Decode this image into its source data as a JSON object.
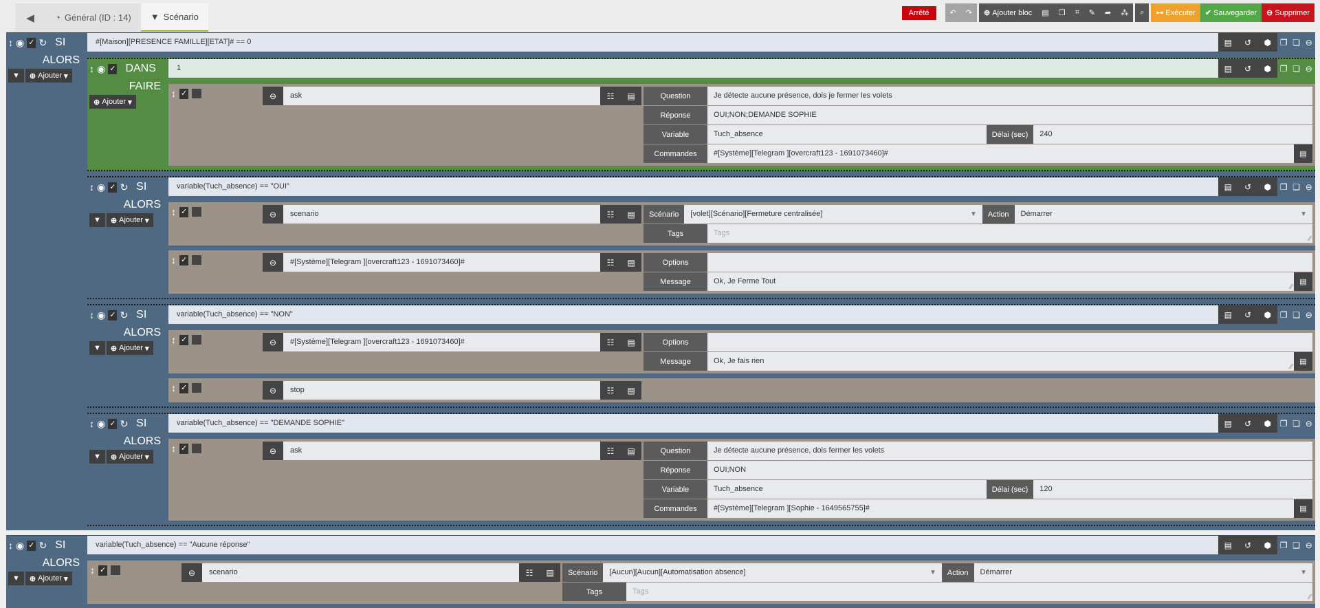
{
  "header": {
    "tabs": [
      {
        "label": "Général (ID : 14)",
        "icon": "dashboard-icon"
      },
      {
        "label": "Scénario",
        "icon": "filter-icon"
      }
    ],
    "status": "Arrêté",
    "add_block": "Ajouter bloc",
    "execute": "Exécuter",
    "save": "Sauvegarder",
    "delete": "Supprimer"
  },
  "labels": {
    "si": "SI",
    "alors": "ALORS",
    "dans": "DANS",
    "faire": "FAIRE",
    "ajouter": "Ajouter"
  },
  "blocks": [
    {
      "kind": "si",
      "condition": "#[Maison][PRESENCE FAMILLE][ETAT]# == 0",
      "children": [
        {
          "kind": "dans",
          "condition": "1",
          "children": [
            {
              "kind": "action",
              "name": "ask",
              "params": [
                [
                  {
                    "label": "Question",
                    "value": "Je détecte aucune présence, dois je fermer les volets"
                  }
                ],
                [
                  {
                    "label": "Réponse",
                    "value": "OUI;NON;DEMANDE SOPHIE"
                  }
                ],
                [
                  {
                    "label": "Variable",
                    "value": "Tuch_absence"
                  },
                  {
                    "label": "Délai (sec)",
                    "value": "240"
                  }
                ],
                [
                  {
                    "label": "Commandes",
                    "value": "#[Système][Telegram ][overcraft123 - 1691073460]#",
                    "button": true
                  }
                ]
              ]
            }
          ]
        },
        {
          "kind": "si",
          "condition": "variable(Tuch_absence) == \"OUI\"",
          "children": [
            {
              "kind": "action",
              "name": "scenario",
              "params": [
                [
                  {
                    "label": "Scénario",
                    "value": "[volet][Scénario][Fermeture centralisée]",
                    "select": true
                  },
                  {
                    "label": "Action",
                    "value": "Démarrer",
                    "select": true
                  }
                ],
                [
                  {
                    "label": "Tags",
                    "placeholder": "Tags",
                    "resize": true
                  }
                ]
              ]
            },
            {
              "kind": "action",
              "name": "#[Système][Telegram ][overcraft123 - 1691073460]#",
              "params": [
                [
                  {
                    "label": "Options",
                    "value": ""
                  }
                ],
                [
                  {
                    "label": "Message",
                    "value": "Ok, Je Ferme Tout",
                    "resize": true,
                    "button": true
                  }
                ]
              ]
            }
          ]
        },
        {
          "kind": "si",
          "condition": "variable(Tuch_absence) == \"NON\"",
          "children": [
            {
              "kind": "action",
              "name": "#[Système][Telegram ][overcraft123 - 1691073460]#",
              "params": [
                [
                  {
                    "label": "Options",
                    "value": ""
                  }
                ],
                [
                  {
                    "label": "Message",
                    "value": "Ok, Je fais rien",
                    "resize": true,
                    "button": true
                  }
                ]
              ]
            },
            {
              "kind": "action",
              "name": "stop",
              "params": []
            }
          ]
        },
        {
          "kind": "si",
          "condition": "variable(Tuch_absence) == \"DEMANDE SOPHIE\"",
          "children": [
            {
              "kind": "action",
              "name": "ask",
              "params": [
                [
                  {
                    "label": "Question",
                    "value": "Je détecte aucune présence, dois fermer les volets"
                  }
                ],
                [
                  {
                    "label": "Réponse",
                    "value": "OUI;NON"
                  }
                ],
                [
                  {
                    "label": "Variable",
                    "value": "Tuch_absence"
                  },
                  {
                    "label": "Délai (sec)",
                    "value": "120"
                  }
                ],
                [
                  {
                    "label": "Commandes",
                    "value": "#[Système][Telegram ][Sophie - 1649565755]#",
                    "button": true
                  }
                ]
              ]
            }
          ]
        }
      ]
    },
    {
      "kind": "si",
      "condition": "variable(Tuch_absence) == \"Aucune réponse\"",
      "children": [
        {
          "kind": "action",
          "name": "scenario",
          "params": [
            [
              {
                "label": "Scénario",
                "value": "[Aucun][Aucun][Automatisation absence]",
                "select": true
              },
              {
                "label": "Action",
                "value": "Démarrer",
                "select": true
              }
            ],
            [
              {
                "label": "Tags",
                "placeholder": "Tags",
                "resize": true
              }
            ]
          ]
        }
      ]
    }
  ]
}
